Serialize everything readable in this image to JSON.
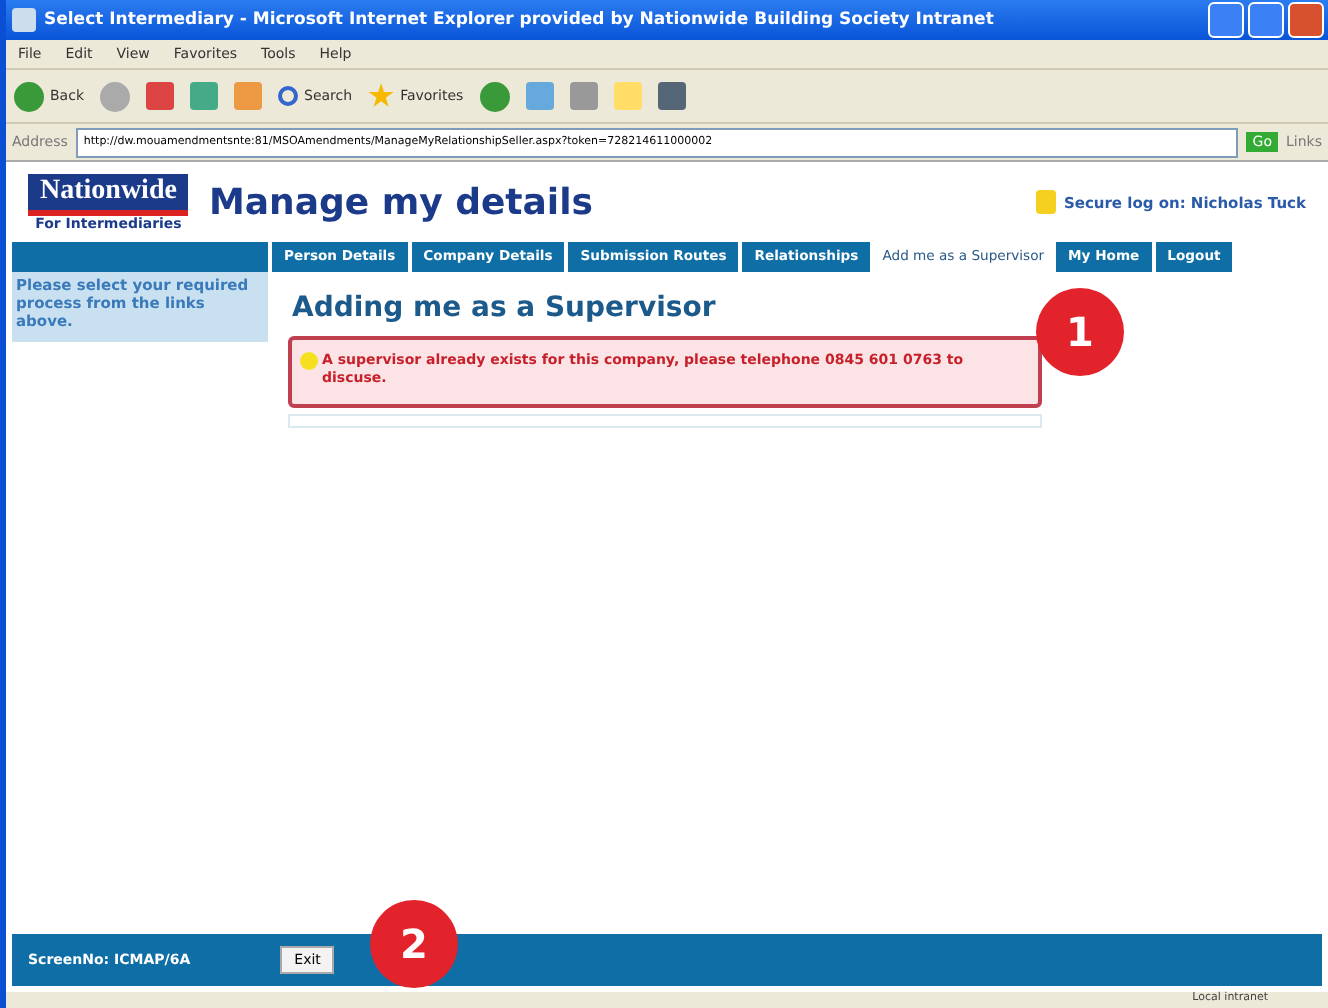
{
  "window": {
    "title": "Select Intermediary - Microsoft Internet Explorer provided by Nationwide Building Society Intranet"
  },
  "menu": [
    "File",
    "Edit",
    "View",
    "Favorites",
    "Tools",
    "Help"
  ],
  "toolbar": {
    "back": "Back",
    "search": "Search",
    "favorites": "Favorites"
  },
  "address": {
    "label": "Address",
    "url": "http://dw.mouamendmentsnte:81/MSOAmendments/ManageMyRelationshipSeller.aspx?token=728214611000002",
    "go": "Go",
    "links": "Links"
  },
  "header": {
    "logo": "Nationwide",
    "logo_sub": "For Intermediaries",
    "title": "Manage my details",
    "secure": "Secure log on: Nicholas Tuck"
  },
  "tabs": [
    {
      "label": "Person Details",
      "selected": false
    },
    {
      "label": "Company Details",
      "selected": false
    },
    {
      "label": "Submission Routes",
      "selected": false
    },
    {
      "label": "Relationships",
      "selected": false
    },
    {
      "label": "Add me as a Supervisor",
      "selected": true
    },
    {
      "label": "My Home",
      "selected": false
    },
    {
      "label": "Logout",
      "selected": false
    }
  ],
  "sidebar": {
    "text": "Please select your required process from the links above."
  },
  "content": {
    "heading": "Adding me as a Supervisor",
    "alert": "A supervisor already exists for this company, please telephone 0845 601 0763 to discuse."
  },
  "footer": {
    "screen_no": "ScreenNo: ICMAP/6A",
    "exit": "Exit"
  },
  "status_bar": {
    "zone": "Local intranet"
  },
  "callouts": [
    "1",
    "2"
  ]
}
